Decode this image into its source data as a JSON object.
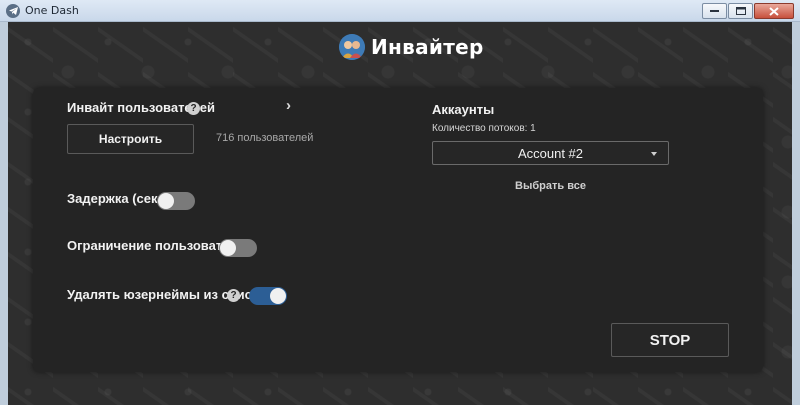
{
  "window": {
    "title": "One Dash",
    "controls": [
      "minimize-icon",
      "maximize-icon",
      "close-icon"
    ]
  },
  "header": {
    "title": "Инвайтер",
    "logo_icon": "app-logo-icon"
  },
  "invite": {
    "label": "Инвайт пользователей",
    "help_icon": "?",
    "expand_icon": "chevron-right-icon",
    "configure_label": "Настроить",
    "users_count": "716 пользователей"
  },
  "delay": {
    "label": "Задержка (сек.)",
    "enabled": false
  },
  "user_limit": {
    "label": "Ограничение пользователей",
    "enabled": false
  },
  "remove_usernames": {
    "label": "Удалять юзернеймы из списка",
    "help_icon": "?",
    "enabled": true
  },
  "accounts": {
    "title": "Аккаунты",
    "threads_label": "Количество потоков: 1",
    "selected": "Account #2",
    "select_all_label": "Выбрать все"
  },
  "actions": {
    "stop_label": "STOP"
  },
  "colors": {
    "panel_bg": "#242424",
    "app_bg": "#2e2e2e",
    "toggle_on": "#2c5e95",
    "toggle_off": "#7a7a7a"
  }
}
